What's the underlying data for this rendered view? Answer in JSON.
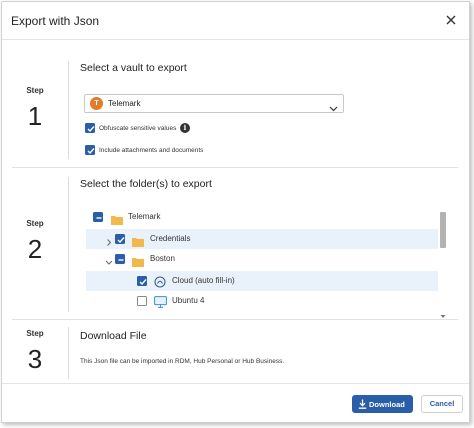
{
  "dialog": {
    "title": "Export with Json"
  },
  "steps": [
    {
      "word": "Step",
      "number": "1",
      "title": "Select a vault to export"
    },
    {
      "word": "Step",
      "number": "2",
      "title": "Select the folder(s) to export"
    },
    {
      "word": "Step",
      "number": "3",
      "title": "Download File"
    }
  ],
  "vault": {
    "avatar_letter": "T",
    "avatar_color": "#e37b2c",
    "selected": "Telemark"
  },
  "options": {
    "obfuscate": {
      "label": "Obfuscate sensitive values",
      "checked": true
    },
    "attachments": {
      "label": "Include attachments and documents",
      "checked": true
    }
  },
  "tree": {
    "items": [
      {
        "label": "Telemark",
        "state": "indeterminate",
        "expander": "none",
        "icon": "folder-icon"
      },
      {
        "label": "Credentials",
        "state": "checked",
        "expander": "collapsed",
        "icon": "folder-icon",
        "selected": true
      },
      {
        "label": "Boston",
        "state": "indeterminate",
        "expander": "expanded",
        "icon": "folder-icon"
      },
      {
        "label": "Cloud (auto fill-in)",
        "state": "checked",
        "expander": "none",
        "icon": "cloud-autofill-icon",
        "selected": true
      },
      {
        "label": "Ubuntu 4",
        "state": "unchecked",
        "expander": "none",
        "icon": "monitor-icon"
      }
    ]
  },
  "download_section": {
    "description": "This Json file can be imported in RDM, Hub Personal or Hub Business."
  },
  "footer": {
    "download_label": "Download",
    "cancel_label": "Cancel"
  },
  "colors": {
    "accent": "#2a5ea8",
    "selection": "#e9f1fb",
    "folder": "#f2b84b"
  }
}
